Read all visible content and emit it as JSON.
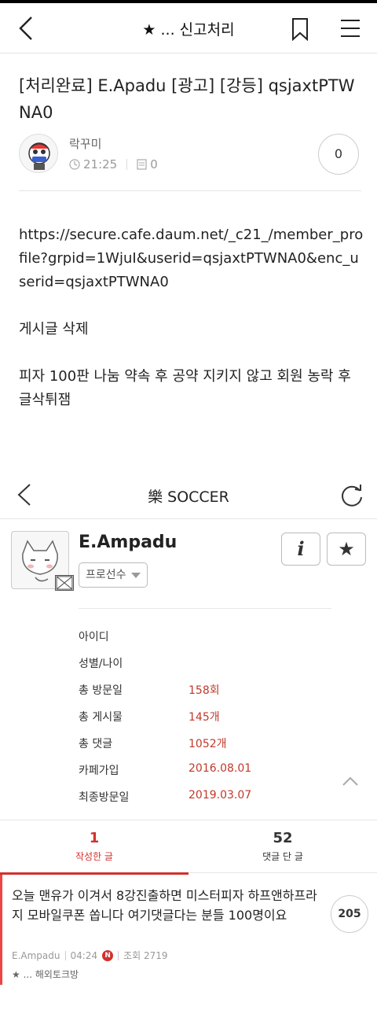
{
  "header": {
    "title": "★ ... 신고처리"
  },
  "post": {
    "title": "[처리완료] E.Apadu [광고] [강등] qsjaxtPTWNA0",
    "author": "락꾸미",
    "time": "21:25",
    "views": "0",
    "comment_count": "0",
    "body": [
      "https://secure.cafe.daum.net/_c21_/member_profile?grpid=1WjuI&userid=qsjaxtPTWNA0&enc_userid=qsjaxtPTWNA0",
      "게시글 삭제",
      "피자 100판 나눔 약속 후 공약 지키지 않고 회원 농락 후 글삭튀잼"
    ]
  },
  "embedded": {
    "nav_title": "樂 SOCCER",
    "profile_name": "E.Ampadu",
    "grade": "프로선수",
    "info_label": "i",
    "star_label": "★",
    "stats": [
      {
        "k": "아이디",
        "v": ""
      },
      {
        "k": "성별/나이",
        "v": ""
      },
      {
        "k": "총 방문일",
        "v": "158회"
      },
      {
        "k": "총 게시물",
        "v": "145개"
      },
      {
        "k": "총 댓글",
        "v": "1052개"
      },
      {
        "k": "카페가입",
        "v": "2016.08.01"
      },
      {
        "k": "최종방문일",
        "v": "2019.03.07"
      }
    ],
    "tabs": [
      {
        "num": "1",
        "label": "작성한 글"
      },
      {
        "num": "52",
        "label": "댓글 단 글"
      }
    ],
    "item": {
      "subject": "오늘 맨유가 이겨서 8강진출하면 미스터피자 하프앤하프라지 모바일쿠폰 쏩니다 여기댓글다는 분들 100명이요",
      "author": "E.Ampadu",
      "time": "04:24",
      "new_badge": "N",
      "views": "조회 2719",
      "board": "★ ... 해외토크방",
      "comments": "205"
    }
  },
  "colors": {
    "accent": "#d0312d"
  }
}
